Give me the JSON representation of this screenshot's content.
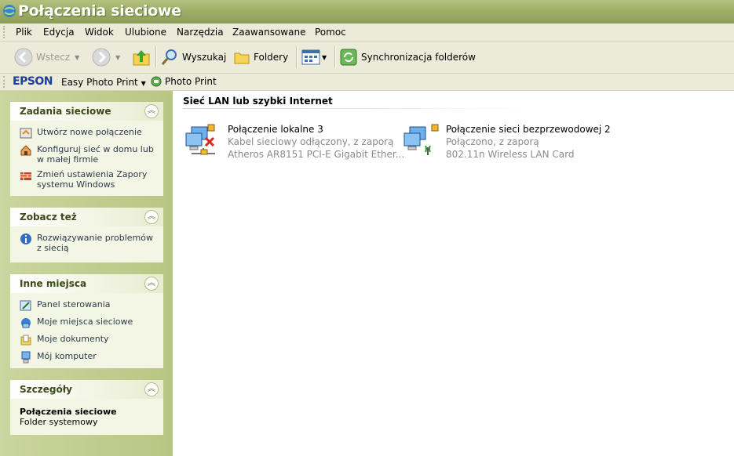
{
  "window": {
    "title": "Połączenia sieciowe"
  },
  "menu": [
    "Plik",
    "Edycja",
    "Widok",
    "Ulubione",
    "Narzędzia",
    "Zaawansowane",
    "Pomoc"
  ],
  "toolbar": {
    "back": "Wstecz",
    "search": "Wyszukaj",
    "folders": "Foldery",
    "sync": "Synchronizacja folderów"
  },
  "epson_bar": {
    "brand": "EPSON",
    "easy_photo_print": "Easy Photo Print",
    "photo_print": "Photo Print"
  },
  "sidebar": {
    "network_tasks": {
      "title": "Zadania sieciowe",
      "items": [
        "Utwórz nowe połączenie",
        "Konfiguruj sieć w domu lub w małej firmie",
        "Zmień ustawienia Zapory systemu Windows"
      ]
    },
    "see_also": {
      "title": "Zobacz też",
      "items": [
        "Rozwiązywanie problemów z siecią"
      ]
    },
    "other_places": {
      "title": "Inne miejsca",
      "items": [
        "Panel sterowania",
        "Moje miejsca sieciowe",
        "Moje dokumenty",
        "Mój komputer"
      ]
    },
    "details": {
      "title": "Szczegóły",
      "name": "Połączenia sieciowe",
      "type": "Folder systemowy"
    }
  },
  "main": {
    "group_title": "Sieć LAN lub szybki Internet",
    "connections": [
      {
        "name": "Połączenie lokalne 3",
        "status": "Kabel sieciowy odłączony, z zaporą",
        "device": "Atheros AR8151 PCI-E Gigabit Ether..."
      },
      {
        "name": "Połączenie sieci bezprzewodowej 2",
        "status": "Połączono, z zaporą",
        "device": "802.11n Wireless LAN Card"
      }
    ]
  }
}
